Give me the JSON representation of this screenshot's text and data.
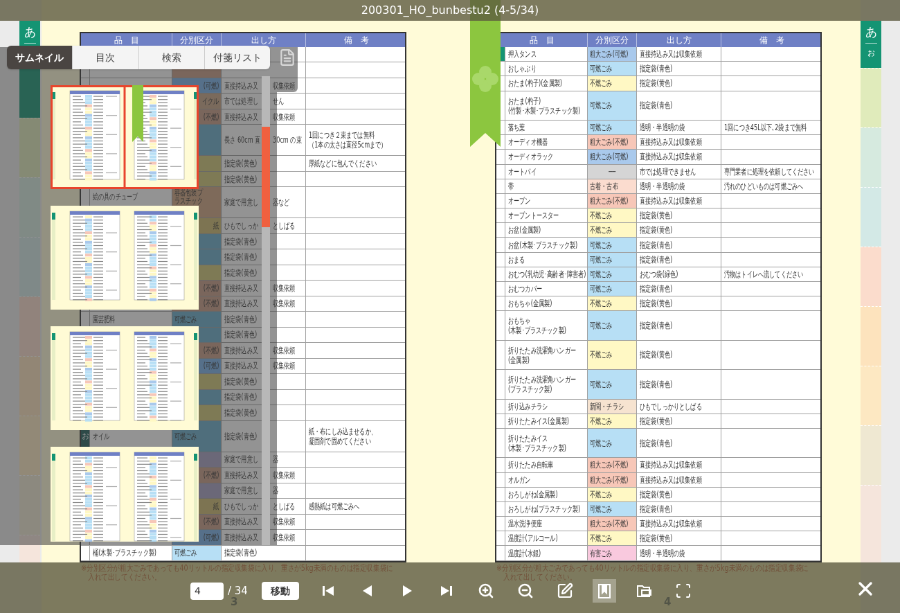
{
  "title": "200301_HO_bunbestu2 (4-5/34)",
  "left_index": [
    "あ"
  ],
  "right_index": [
    "あ",
    "お"
  ],
  "spread": {
    "bookmarked": true
  },
  "pages": [
    {
      "headers": [
        "品　目",
        "分別区分",
        "出し方",
        "備　考"
      ],
      "rows": [
        {
          "tall": false
        },
        {
          "tall": false,
          "color": "#7a665c"
        },
        {
          "tall": false,
          "color": "#56708a",
          "category_tail": "(可燃)",
          "method": [
            "直接持込み又",
            "収集依頼"
          ]
        },
        {
          "tall": false,
          "color": "#7a6a5c",
          "category_tail": "イクル",
          "method": [
            "市では処理し",
            "せん"
          ]
        },
        {
          "tall": false,
          "color": "#7a665c",
          "category_tail": "(不燃)",
          "method": [
            "直接持込み又",
            "収集依頼"
          ]
        },
        {
          "tall": true,
          "color": "#4f6e7c",
          "method": [
            "長さ 60cm 直",
            "30cm の束"
          ],
          "note": [
            "1回につき２束までは無料",
            "（1本の太さは直径5cmまで）"
          ]
        },
        {
          "tall": false,
          "color": "#7e7a55",
          "method": "指定袋(黄色)",
          "note": "厚紙などに包んでください"
        },
        {
          "tall": false,
          "color": "#7e7a55",
          "method": "指定袋(黄色)"
        },
        {
          "tall": true,
          "color": "#7e6a5a",
          "item": [
            "絵の具のチューブ"
          ],
          "category": "容器包装プラスチック",
          "method": [
            "家庭で用意し",
            "器など"
          ]
        },
        {
          "tall": false,
          "color": "#7d7452",
          "category_tail": "紙",
          "method": [
            "ひもでしっか",
            "としばる"
          ]
        },
        {
          "tall": false,
          "color": "#4f6e7c",
          "method": "指定袋(青色)"
        },
        {
          "tall": false,
          "color": "#4f6e7c",
          "method": "指定袋(青色)"
        },
        {
          "tall": false,
          "color": "#7e7a55",
          "method": "指定袋(黄色)"
        },
        {
          "tall": false,
          "color": "#7a665c",
          "category_tail": "(不燃)",
          "method": [
            "直接持込み又",
            "収集依頼"
          ]
        },
        {
          "tall": false,
          "color": "#7a665c",
          "category_tail": "(不燃)",
          "method": [
            "直接持込み又",
            "収集依頼"
          ]
        },
        {
          "tall": false,
          "color": "#4f6e7c",
          "item": "園芸肥料",
          "category": "可燃ごみ",
          "method": "指定袋(青色)"
        },
        {
          "tall": false,
          "color": "#4f6e7c",
          "method": "指定袋(青色)"
        },
        {
          "tall": false,
          "color": "#7a665c",
          "category_tail": "(不燃)",
          "method": [
            "直接持込み又",
            "収集依頼"
          ]
        },
        {
          "tall": false,
          "color": "#56708a",
          "category_tail": "(可燃)",
          "method": [
            "直接持込み又",
            "収集依頼"
          ]
        },
        {
          "tall": false,
          "color": "#7e7a55",
          "method": "指定袋(黄色)"
        },
        {
          "tall": false,
          "color": "#4f6e7c",
          "method": "指定袋(青色)"
        },
        {
          "tall": false,
          "color": "#7e7a55",
          "method": "指定袋(黄色)"
        },
        {
          "tall": true,
          "marker": "お",
          "color": "#4f6e7c",
          "item": "オイル",
          "category": "可燃ごみ",
          "method": "指定袋(青色)",
          "note": [
            "紙・布にしみ込ませるか、",
            "凝固剤で固めてください"
          ]
        },
        {
          "tall": false,
          "color": "#6b6878",
          "method": [
            "家庭で用意し",
            "器"
          ]
        },
        {
          "tall": false,
          "color": "#7a665c",
          "category_tail": "(不燃)",
          "method": [
            "直接持込み又",
            "収集依頼"
          ]
        },
        {
          "tall": false,
          "color": "#6b6878",
          "method": [
            "家庭で用意し",
            "器"
          ]
        },
        {
          "tall": false,
          "color": "#7d7452",
          "category_tail": "紙",
          "method": [
            "ひもでしっか",
            "としばる"
          ],
          "note": "感熱紙は可燃ごみへ"
        },
        {
          "tall": false,
          "color": "#7a665c",
          "category_tail": "(不燃)",
          "method": [
            "直接持込み又",
            "収集依頼"
          ]
        },
        {
          "tall": false,
          "color": "#56708a",
          "category_tail": "(可燃)",
          "method": [
            "直接持込み又",
            "収集依頼"
          ]
        },
        {
          "tall": false,
          "color": "#b7dff5",
          "item": "桶(木製･プラスチック製)",
          "category": "可燃ごみ",
          "method": "指定袋(青色)"
        }
      ],
      "footnote": [
        "※分別区分が粗大ごみであっても40リットルの指定収集袋に入り、重さが5kg未満のものは指定収集袋に",
        "入れて出してください。"
      ],
      "page_number": "3"
    },
    {
      "headers": [
        "品　目",
        "分別区分",
        "出し方",
        "備　考"
      ],
      "rows": [
        {
          "tall": false,
          "marked": true,
          "color": "#a9c9ec",
          "item": "押入タンス",
          "category": "粗大ごみ(可燃)",
          "method": "直接持込み又は収集依頼"
        },
        {
          "tall": false,
          "marked": false,
          "color": "#b7dff5",
          "item": "おしゃぶり",
          "category": "可燃ごみ",
          "method": "指定袋(青色)"
        },
        {
          "tall": false,
          "marked": false,
          "color": "#fff8c4",
          "item": "おたま(杓子)(金属製)",
          "category": "不燃ごみ",
          "method": "指定袋(黄色)"
        },
        {
          "tall": true,
          "marked": false,
          "color": "#b7dff5",
          "item": [
            "おたま(杓子)",
            "(竹製･木製･プラスチック製)"
          ],
          "category": "可燃ごみ",
          "method": "指定袋(青色)"
        },
        {
          "tall": false,
          "marked": false,
          "color": "#b7dff5",
          "item": "落ち葉",
          "category": "可燃ごみ",
          "method": "透明・半透明の袋",
          "note": "1回につき45L以下､2袋まで無料"
        },
        {
          "tall": false,
          "marked": false,
          "color": "#f7c7b8",
          "item": "オーディオ機器",
          "category": "粗大ごみ(不燃)",
          "method": "直接持込み又は収集依頼"
        },
        {
          "tall": false,
          "marked": false,
          "color": "#a9c9ec",
          "item": "オーディオラック",
          "category": "粗大ごみ(可燃)",
          "method": "直接持込み又は収集依頼"
        },
        {
          "tall": false,
          "marked": false,
          "color": "#d5d5d5",
          "item": "オートバイ",
          "category": "──",
          "method": "市では処理できません",
          "note": "専門業者に処理を依頼してください"
        },
        {
          "tall": false,
          "marked": false,
          "color": "#fbdccf",
          "item": "帯",
          "category": "古着・古布",
          "method": "透明・半透明の袋",
          "note": "汚れのひどいものは可燃ごみへ"
        },
        {
          "tall": false,
          "marked": false,
          "color": "#f7c7b8",
          "item": "オーブン",
          "category": "粗大ごみ(不燃)",
          "method": "直接持込み又は収集依頼"
        },
        {
          "tall": false,
          "marked": false,
          "color": "#fff8c4",
          "item": "オーブントースター",
          "category": "不燃ごみ",
          "method": "指定袋(黄色)"
        },
        {
          "tall": false,
          "marked": false,
          "color": "#fff8c4",
          "item": "お盆(金属製)",
          "category": "不燃ごみ",
          "method": "指定袋(黄色)"
        },
        {
          "tall": false,
          "marked": false,
          "color": "#b7dff5",
          "item": "お盆(木製･プラスチック製)",
          "category": "可燃ごみ",
          "method": "指定袋(青色)"
        },
        {
          "tall": false,
          "marked": false,
          "color": "#b7dff5",
          "item": "おまる",
          "category": "可燃ごみ",
          "method": "指定袋(青色)"
        },
        {
          "tall": false,
          "marked": false,
          "color": "#b7dff5",
          "item": "おむつ(乳幼児･高齢者･障害者)",
          "category": "可燃ごみ",
          "method": "おむつ袋(緑色)",
          "note": "汚物はトイレへ流してください"
        },
        {
          "tall": false,
          "marked": false,
          "color": "#b7dff5",
          "item": "おむつカバー",
          "category": "可燃ごみ",
          "method": "指定袋(青色)"
        },
        {
          "tall": false,
          "marked": false,
          "color": "#fff8c4",
          "item": "おもちゃ(金属製)",
          "category": "不燃ごみ",
          "method": "指定袋(黄色)"
        },
        {
          "tall": true,
          "marked": false,
          "color": "#b7dff5",
          "item": [
            "おもちゃ",
            "(木製･プラスチック製)"
          ],
          "category": "可燃ごみ",
          "method": "指定袋(青色)"
        },
        {
          "tall": true,
          "marked": false,
          "color": "#fff8c4",
          "item": [
            "折りたたみ洗濯角ハンガー",
            "(金属製)"
          ],
          "category": "不燃ごみ",
          "method": "指定袋(黄色)"
        },
        {
          "tall": true,
          "marked": false,
          "color": "#b7dff5",
          "item": [
            "折りたたみ洗濯角ハンガー",
            "(プラスチック製)"
          ],
          "category": "可燃ごみ",
          "method": "指定袋(青色)"
        },
        {
          "tall": false,
          "marked": false,
          "color": "#f6e3d0",
          "item": "折り込みチラシ",
          "category": "新聞・チラシ",
          "method": "ひもでしっかりとしばる"
        },
        {
          "tall": false,
          "marked": false,
          "color": "#fff8c4",
          "item": "折りたたみイス(金属製)",
          "category": "不燃ごみ",
          "method": "指定袋(黄色)"
        },
        {
          "tall": true,
          "marked": false,
          "color": "#b7dff5",
          "item": [
            "折りたたみイス",
            "(木製･プラスチック製)"
          ],
          "category": "可燃ごみ",
          "method": "指定袋(青色)"
        },
        {
          "tall": false,
          "marked": false,
          "color": "#f7c7b8",
          "item": "折りたたみ自転車",
          "category": "粗大ごみ(不燃)",
          "method": "直接持込み又は収集依頼"
        },
        {
          "tall": false,
          "marked": false,
          "color": "#f7c7b8",
          "item": "オルガン",
          "category": "粗大ごみ(不燃)",
          "method": "直接持込み又は収集依頼"
        },
        {
          "tall": false,
          "marked": false,
          "color": "#fff8c4",
          "item": "おろしがね(金属製)",
          "category": "不燃ごみ",
          "method": "指定袋(黄色)"
        },
        {
          "tall": false,
          "marked": false,
          "color": "#b7dff5",
          "item": "おろしがね(プラスチック製)",
          "category": "可燃ごみ",
          "method": "指定袋(青色)"
        },
        {
          "tall": false,
          "marked": false,
          "color": "#f7c7b8",
          "item": "温水洗浄便座",
          "category": "粗大ごみ(不燃)",
          "method": "直接持込み又は収集依頼"
        },
        {
          "tall": false,
          "marked": false,
          "color": "#fff8c4",
          "item": "温度計(アルコール)",
          "category": "不燃ごみ",
          "method": "指定袋(黄色)"
        },
        {
          "tall": false,
          "marked": false,
          "color": "#f9c9de",
          "item": "温度計(水銀)",
          "category": "有害ごみ",
          "method": "透明・半透明の袋"
        }
      ],
      "footnote": [
        "※分別区分が粗大ごみであっても40リットルの指定収集袋に入り、重さが5kg未満のものは指定収集袋に",
        "入れて出してください。"
      ],
      "page_number": "4"
    }
  ],
  "panel": {
    "tabs": [
      {
        "label": "サムネイル",
        "selected": true
      },
      {
        "label": "目次",
        "selected": false
      },
      {
        "label": "検索",
        "selected": false
      },
      {
        "label": "付箋リスト",
        "selected": false
      }
    ],
    "thumbnails": [
      {
        "selected": true,
        "bookmarked": true
      },
      {
        "selected": false,
        "bookmarked": false
      },
      {
        "selected": false,
        "bookmarked": false
      },
      {
        "selected": false,
        "bookmarked": false
      }
    ]
  },
  "toolbar": {
    "page_input": {
      "value": "4"
    },
    "page_total": "/ 34",
    "go_button": "移動",
    "buttons": [
      {
        "kind": "first",
        "active": false
      },
      {
        "kind": "prev",
        "active": false
      },
      {
        "kind": "next",
        "active": false
      },
      {
        "kind": "last",
        "active": false
      },
      {
        "kind": "zoom_in",
        "active": false
      },
      {
        "kind": "zoom_out",
        "active": false
      },
      {
        "kind": "edit",
        "active": false
      },
      {
        "kind": "bookmark",
        "active": true
      },
      {
        "kind": "share",
        "active": false
      },
      {
        "kind": "fullscreen",
        "active": false
      }
    ]
  }
}
